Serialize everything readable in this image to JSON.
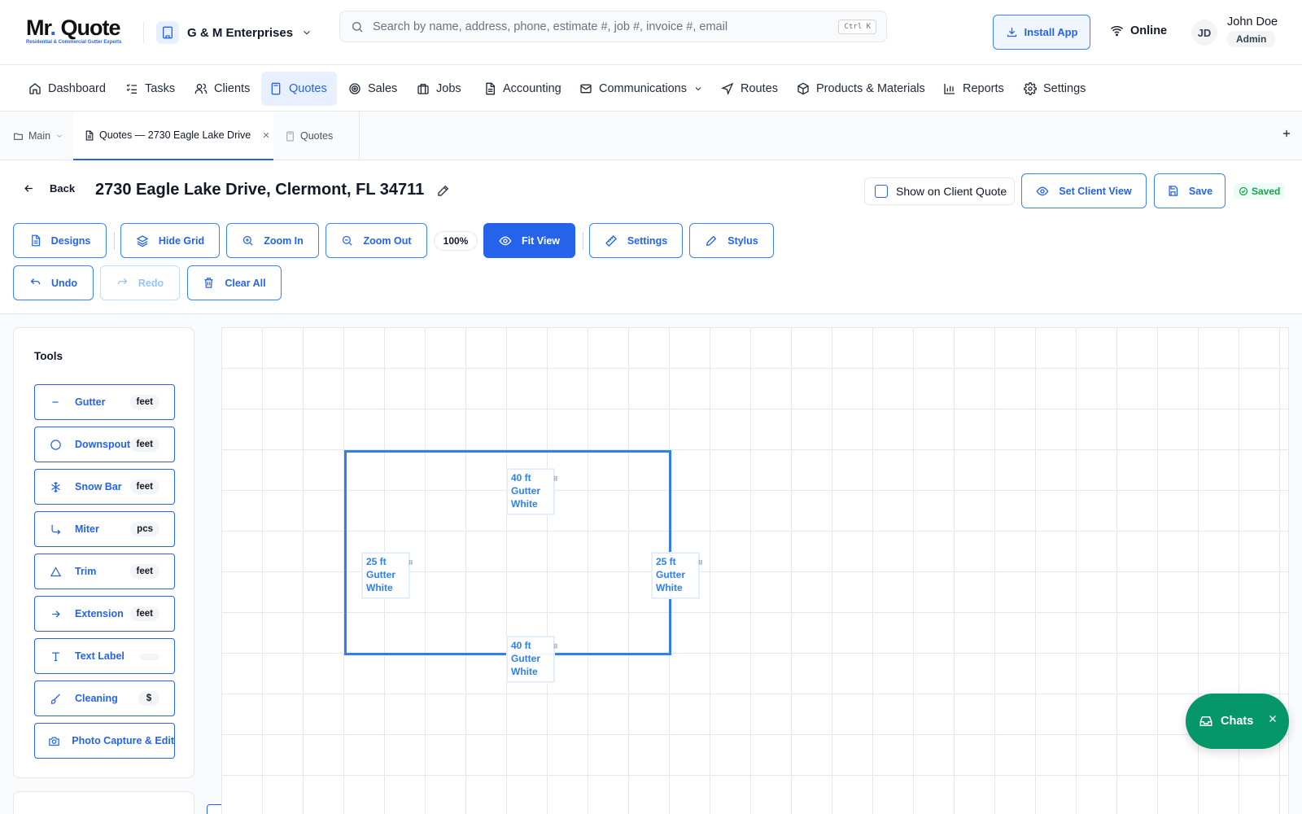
{
  "header": {
    "logo_title_main": "Mr",
    "logo_title_dot": ".",
    "logo_title_rest": " Quote",
    "logo_subtitle": "Residential & Commercial Gutter Experts",
    "company_name": "G & M Enterprises",
    "search_placeholder": "Search by name, address, phone, estimate #, job #, invoice #, email",
    "search_shortcut": "Ctrl K",
    "install_label": "Install App",
    "status": "Online",
    "user_initials": "JD",
    "user_name": "John Doe",
    "user_role": "Admin"
  },
  "nav": {
    "items": [
      {
        "label": "Dashboard",
        "icon": "home-icon"
      },
      {
        "label": "Tasks",
        "icon": "tasks-icon"
      },
      {
        "label": "Clients",
        "icon": "users-icon"
      },
      {
        "label": "Quotes",
        "icon": "calculator-icon",
        "active": true
      },
      {
        "label": "Sales",
        "icon": "target-icon"
      },
      {
        "label": "Jobs",
        "icon": "briefcase-icon"
      },
      {
        "label": "Accounting",
        "icon": "document-icon"
      },
      {
        "label": "Communications",
        "icon": "mail-icon"
      },
      {
        "label": "Routes",
        "icon": "navigation-icon"
      },
      {
        "label": "Products & Materials",
        "icon": "box-icon"
      },
      {
        "label": "Reports",
        "icon": "bar-chart-icon"
      },
      {
        "label": "Settings",
        "icon": "gear-icon"
      }
    ]
  },
  "tabs": {
    "main_label": "Main",
    "active_label": "Quotes — 2730 Eagle Lake Drive",
    "quotes_label": "Quotes"
  },
  "page": {
    "back_label": "Back",
    "title": "2730 Eagle Lake Drive, Clermont, FL 34711",
    "show_on_client_quote": "Show on Client Quote",
    "set_client_view": "Set Client View",
    "save_label": "Save",
    "saved_label": "Saved"
  },
  "toolbar": {
    "designs": "Designs",
    "hide_grid": "Hide Grid",
    "zoom_in": "Zoom In",
    "zoom_out": "Zoom Out",
    "zoom_level": "100%",
    "fit_view": "Fit View",
    "settings": "Settings",
    "stylus": "Stylus",
    "undo": "Undo",
    "redo": "Redo",
    "clear_all": "Clear All"
  },
  "tools": {
    "title": "Tools",
    "items": [
      {
        "label": "Gutter",
        "unit": "feet",
        "icon": "minus-icon"
      },
      {
        "label": "Downspout",
        "unit": "feet",
        "icon": "circle-icon"
      },
      {
        "label": "Snow Bar",
        "unit": "feet",
        "icon": "snowflake-icon"
      },
      {
        "label": "Miter",
        "unit": "pcs",
        "icon": "corner-arrow-icon"
      },
      {
        "label": "Trim",
        "unit": "feet",
        "icon": "triangle-icon"
      },
      {
        "label": "Extension",
        "unit": "feet",
        "icon": "arrow-right-icon"
      },
      {
        "label": "Text Label",
        "unit": "",
        "icon": "text-icon"
      },
      {
        "label": "Cleaning",
        "unit": "$",
        "icon": "brush-icon"
      },
      {
        "label": "Photo Capture & Edit",
        "unit": "",
        "icon": "camera-icon"
      }
    ]
  },
  "canvas": {
    "labels": [
      {
        "length": "40 ft",
        "type": "Gutter",
        "color": "White",
        "side": "top"
      },
      {
        "length": "25 ft",
        "type": "Gutter",
        "color": "White",
        "side": "left"
      },
      {
        "length": "25 ft",
        "type": "Gutter",
        "color": "White",
        "side": "right"
      },
      {
        "length": "40 ft",
        "type": "Gutter",
        "color": "White",
        "side": "bottom"
      }
    ]
  },
  "chat": {
    "label": "Chats"
  },
  "colors": {
    "accent": "#2563eb",
    "drawing": "#2f80ed",
    "chat": "#059669",
    "saved": "#16a34a"
  }
}
